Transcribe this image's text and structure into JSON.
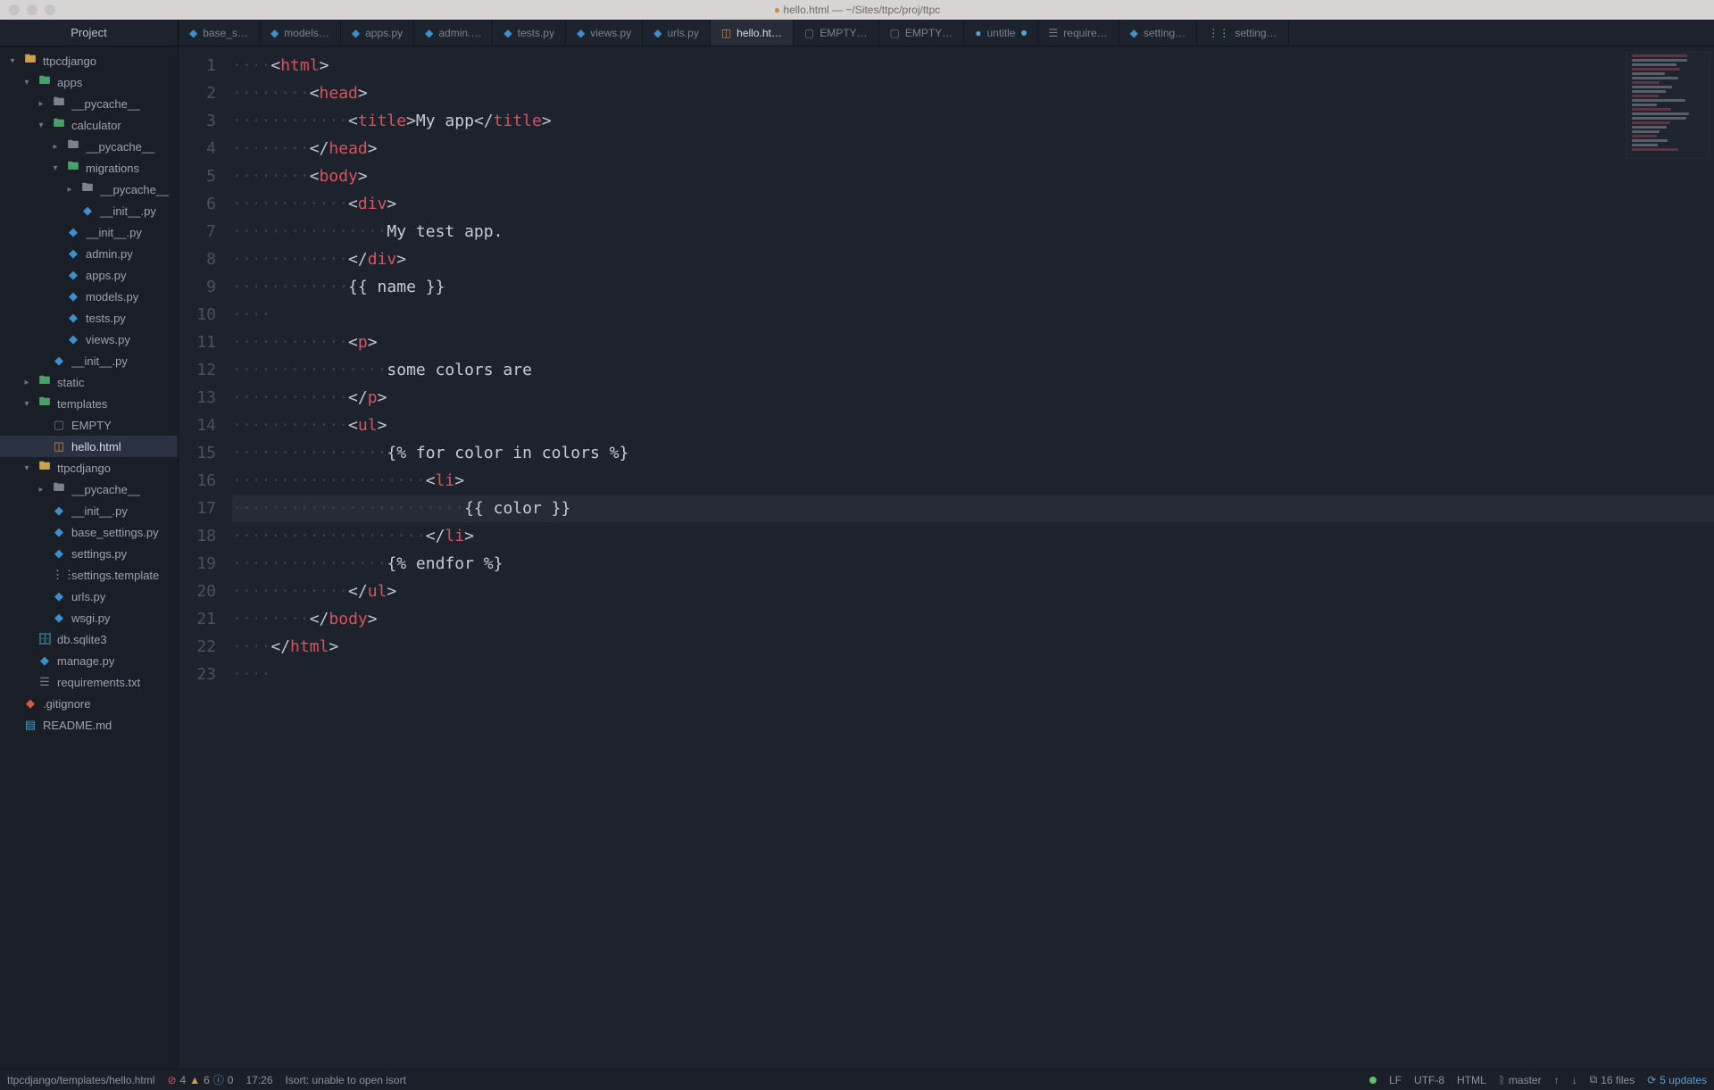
{
  "window": {
    "title": "hello.html — ~/Sites/ttpc/proj/ttpc",
    "title_dot_color": "#d08a3e"
  },
  "project_tab": "Project",
  "tabs": [
    {
      "label": "base_s…",
      "icon": "python-icon",
      "iconClass": "ic-py"
    },
    {
      "label": "models…",
      "icon": "python-icon",
      "iconClass": "ic-py"
    },
    {
      "label": "apps.py",
      "icon": "python-icon",
      "iconClass": "ic-py"
    },
    {
      "label": "admin.…",
      "icon": "python-icon",
      "iconClass": "ic-py"
    },
    {
      "label": "tests.py",
      "icon": "python-icon",
      "iconClass": "ic-py"
    },
    {
      "label": "views.py",
      "icon": "python-icon",
      "iconClass": "ic-py"
    },
    {
      "label": "urls.py",
      "icon": "python-icon",
      "iconClass": "ic-py"
    },
    {
      "label": "hello.ht…",
      "icon": "html-icon",
      "iconClass": "ic-html",
      "active": true
    },
    {
      "label": "EMPTY…",
      "icon": "file-icon",
      "iconClass": "ic-empty"
    },
    {
      "label": "EMPTY…",
      "icon": "file-icon",
      "iconClass": "ic-empty"
    },
    {
      "label": "untitle",
      "icon": "dot-icon",
      "iconClass": "",
      "modified": true
    },
    {
      "label": "require…",
      "icon": "text-icon",
      "iconClass": "ic-txt"
    },
    {
      "label": "setting…",
      "icon": "python-icon",
      "iconClass": "ic-py"
    },
    {
      "label": "setting…",
      "icon": "template-icon",
      "iconClass": "ic-tmpl"
    }
  ],
  "tree": [
    {
      "d": 0,
      "tw": "▾",
      "icon": "folder-open-icon",
      "ic": "ic-folder-pkg",
      "name": "ttpcdjango"
    },
    {
      "d": 1,
      "tw": "▾",
      "icon": "folder-open-icon",
      "ic": "ic-folder-open",
      "name": "apps"
    },
    {
      "d": 2,
      "tw": "▸",
      "icon": "folder-icon",
      "ic": "ic-folder",
      "name": "__pycache__"
    },
    {
      "d": 2,
      "tw": "▾",
      "icon": "folder-open-icon",
      "ic": "ic-folder-open",
      "name": "calculator"
    },
    {
      "d": 3,
      "tw": "▸",
      "icon": "folder-icon",
      "ic": "ic-folder",
      "name": "__pycache__"
    },
    {
      "d": 3,
      "tw": "▾",
      "icon": "folder-open-icon",
      "ic": "ic-folder-open",
      "name": "migrations"
    },
    {
      "d": 4,
      "tw": "▸",
      "icon": "folder-icon",
      "ic": "ic-folder",
      "name": "__pycache__"
    },
    {
      "d": 4,
      "tw": "",
      "icon": "python-icon",
      "ic": "ic-py",
      "name": "__init__.py"
    },
    {
      "d": 3,
      "tw": "",
      "icon": "python-icon",
      "ic": "ic-py",
      "name": "__init__.py"
    },
    {
      "d": 3,
      "tw": "",
      "icon": "python-icon",
      "ic": "ic-py",
      "name": "admin.py"
    },
    {
      "d": 3,
      "tw": "",
      "icon": "python-icon",
      "ic": "ic-py",
      "name": "apps.py"
    },
    {
      "d": 3,
      "tw": "",
      "icon": "python-icon",
      "ic": "ic-py",
      "name": "models.py"
    },
    {
      "d": 3,
      "tw": "",
      "icon": "python-icon",
      "ic": "ic-py",
      "name": "tests.py"
    },
    {
      "d": 3,
      "tw": "",
      "icon": "python-icon",
      "ic": "ic-py",
      "name": "views.py"
    },
    {
      "d": 2,
      "tw": "",
      "icon": "python-icon",
      "ic": "ic-py",
      "name": "__init__.py"
    },
    {
      "d": 1,
      "tw": "▸",
      "icon": "folder-icon",
      "ic": "ic-folder-open",
      "name": "static"
    },
    {
      "d": 1,
      "tw": "▾",
      "icon": "folder-open-icon",
      "ic": "ic-folder-open",
      "name": "templates"
    },
    {
      "d": 2,
      "tw": "",
      "icon": "file-icon",
      "ic": "ic-empty",
      "name": "EMPTY"
    },
    {
      "d": 2,
      "tw": "",
      "icon": "html-icon",
      "ic": "ic-html",
      "name": "hello.html",
      "selected": true
    },
    {
      "d": 1,
      "tw": "▾",
      "icon": "folder-open-icon",
      "ic": "ic-folder-pkg",
      "name": "ttpcdjango"
    },
    {
      "d": 2,
      "tw": "▸",
      "icon": "folder-icon",
      "ic": "ic-folder",
      "name": "__pycache__"
    },
    {
      "d": 2,
      "tw": "",
      "icon": "python-icon",
      "ic": "ic-py",
      "name": "__init__.py"
    },
    {
      "d": 2,
      "tw": "",
      "icon": "python-icon",
      "ic": "ic-py",
      "name": "base_settings.py"
    },
    {
      "d": 2,
      "tw": "",
      "icon": "python-icon",
      "ic": "ic-py",
      "name": "settings.py"
    },
    {
      "d": 2,
      "tw": "",
      "icon": "template-icon",
      "ic": "ic-tmpl",
      "name": "settings.template"
    },
    {
      "d": 2,
      "tw": "",
      "icon": "python-icon",
      "ic": "ic-py",
      "name": "urls.py"
    },
    {
      "d": 2,
      "tw": "",
      "icon": "python-icon",
      "ic": "ic-py",
      "name": "wsgi.py"
    },
    {
      "d": 1,
      "tw": "",
      "icon": "database-icon",
      "ic": "ic-db",
      "name": "db.sqlite3"
    },
    {
      "d": 1,
      "tw": "",
      "icon": "python-icon",
      "ic": "ic-py",
      "name": "manage.py"
    },
    {
      "d": 1,
      "tw": "",
      "icon": "text-icon",
      "ic": "ic-txt",
      "name": "requirements.txt"
    },
    {
      "d": 0,
      "tw": "",
      "icon": "git-icon",
      "ic": "ic-git",
      "name": ".gitignore"
    },
    {
      "d": 0,
      "tw": "",
      "icon": "markdown-icon",
      "ic": "ic-md",
      "name": "README.md"
    }
  ],
  "code": [
    {
      "n": 1,
      "i": 0,
      "t": "open",
      "tag": "html"
    },
    {
      "n": 2,
      "i": 1,
      "t": "open",
      "tag": "head"
    },
    {
      "n": 3,
      "i": 2,
      "t": "wrap",
      "tag": "title",
      "text": "My app"
    },
    {
      "n": 4,
      "i": 1,
      "t": "close",
      "tag": "head"
    },
    {
      "n": 5,
      "i": 1,
      "t": "open",
      "tag": "body"
    },
    {
      "n": 6,
      "i": 2,
      "t": "open",
      "tag": "div"
    },
    {
      "n": 7,
      "i": 3,
      "t": "text",
      "text": "My test app."
    },
    {
      "n": 8,
      "i": 2,
      "t": "close",
      "tag": "div"
    },
    {
      "n": 9,
      "i": 2,
      "t": "tmpl",
      "text": "{{ name }}"
    },
    {
      "n": 10,
      "i": 0,
      "t": "blank"
    },
    {
      "n": 11,
      "i": 2,
      "t": "open",
      "tag": "p"
    },
    {
      "n": 12,
      "i": 3,
      "t": "text",
      "text": "some colors are"
    },
    {
      "n": 13,
      "i": 2,
      "t": "close",
      "tag": "p"
    },
    {
      "n": 14,
      "i": 2,
      "t": "open",
      "tag": "ul"
    },
    {
      "n": 15,
      "i": 3,
      "t": "tmpl",
      "text": "{% for color in colors %}"
    },
    {
      "n": 16,
      "i": 4,
      "t": "open",
      "tag": "li"
    },
    {
      "n": 17,
      "i": 5,
      "t": "tmpl",
      "text": "{{ color }}",
      "hl": true
    },
    {
      "n": 18,
      "i": 4,
      "t": "close",
      "tag": "li"
    },
    {
      "n": 19,
      "i": 3,
      "t": "tmpl",
      "text": "{% endfor %}"
    },
    {
      "n": 20,
      "i": 2,
      "t": "close",
      "tag": "ul"
    },
    {
      "n": 21,
      "i": 1,
      "t": "close",
      "tag": "body"
    },
    {
      "n": 22,
      "i": 0,
      "t": "close",
      "tag": "html"
    },
    {
      "n": 23,
      "i": 0,
      "t": "blank"
    }
  ],
  "statusbar": {
    "path": "ttpcdjango/templates/hello.html",
    "errors": "4",
    "warnings": "6",
    "info": "0",
    "cursor": "17:26",
    "isort": "Isort: unable to open isort",
    "line_ending": "LF",
    "encoding": "UTF-8",
    "language": "HTML",
    "branch_label": "master",
    "files_count": "16 files",
    "updates": "5 updates"
  },
  "icon_glyphs": {
    "python-icon": "◆",
    "html-icon": "◫",
    "file-icon": "▢",
    "text-icon": "☰",
    "template-icon": "⋮⋮",
    "folder-icon": "▸",
    "folder-open-icon": "▾",
    "git-icon": "◆",
    "markdown-icon": "▤",
    "database-icon": "🗄",
    "dot-icon": "●",
    "branch-icon": "ᚱ",
    "push-icon": "↑",
    "pull-icon": "↓",
    "box-icon": "⧉",
    "update-icon": "⟳"
  }
}
